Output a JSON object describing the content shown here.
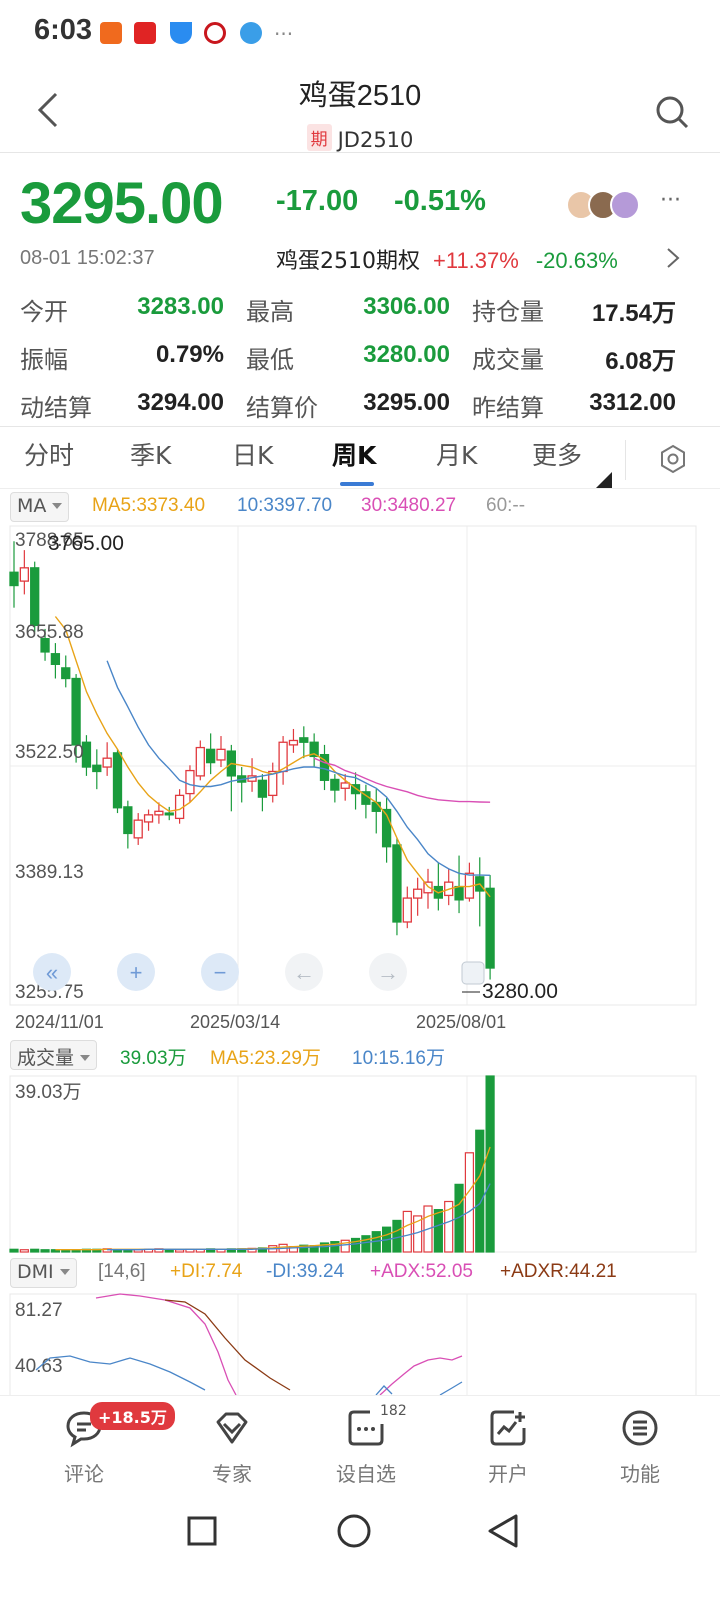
{
  "status_bar": {
    "time": "6:03",
    "more": "···"
  },
  "header": {
    "title": "鸡蛋2510",
    "tag": "期",
    "code": "JD2510"
  },
  "quote": {
    "last_price": "3295.00",
    "change": "-17.00",
    "change_pct": "-0.51%",
    "time": "08-01 15:02:37",
    "option_label": "鸡蛋2510期权",
    "option_up": "+11.37%",
    "option_down": "-20.63%",
    "more": "···"
  },
  "stats": [
    {
      "label": "今开",
      "value": "3283.00",
      "color": "green"
    },
    {
      "label": "最高",
      "value": "3306.00",
      "color": "green"
    },
    {
      "label": "持仓量",
      "value": "17.54万",
      "color": "black"
    },
    {
      "label": "振幅",
      "value": "0.79%",
      "color": "black"
    },
    {
      "label": "最低",
      "value": "3280.00",
      "color": "green"
    },
    {
      "label": "成交量",
      "value": "6.08万",
      "color": "black"
    },
    {
      "label": "动结算",
      "value": "3294.00",
      "color": "black"
    },
    {
      "label": "结算价",
      "value": "3295.00",
      "color": "black"
    },
    {
      "label": "昨结算",
      "value": "3312.00",
      "color": "black"
    }
  ],
  "tabs": [
    {
      "label": "分时",
      "active": false
    },
    {
      "label": "季K",
      "active": false
    },
    {
      "label": "日K",
      "active": false
    },
    {
      "label": "周K",
      "active": true
    },
    {
      "label": "月K",
      "active": false
    },
    {
      "label": "更多",
      "active": false
    }
  ],
  "ma_header": {
    "selector": "MA",
    "ma5": "MA5:3373.40",
    "ma10": "10:3397.70",
    "ma30": "30:3480.27",
    "ma60": "60:--"
  },
  "volume_header": {
    "selector": "成交量",
    "vol": "39.03万",
    "ma5": "MA5:23.29万",
    "ma10": "10:15.16万"
  },
  "dmi_header": {
    "selector": "DMI",
    "params": "[14,6]",
    "pdi": "+DI:7.74",
    "mdi": "-DI:39.24",
    "adx": "+ADX:52.05",
    "adxr": "+ADXR:44.21"
  },
  "colors": {
    "up": "#e0393e",
    "down": "#1a9b3c",
    "ma5": "#e8a317",
    "ma10": "#4a86c8",
    "ma30": "#d94fb5"
  },
  "chart_data": {
    "type": "candlestick",
    "y_ticks": [
      "3788.65",
      "3655.88",
      "3522.50",
      "3389.13",
      "3255.75"
    ],
    "ylim": [
      3255.75,
      3788.65
    ],
    "high_label": "3765.00",
    "low_label": "3280.00",
    "x_ticks": [
      "2024/11/01",
      "2025/03/14",
      "2025/08/01"
    ],
    "volume_max_label": "39.03万",
    "dmi_ticks": [
      "81.27",
      "40.63"
    ],
    "ohlc": [
      [
        3740,
        3775,
        3725,
        3700
      ],
      [
        3730,
        3765,
        3745,
        3715
      ],
      [
        3745,
        3752,
        3680,
        3672
      ],
      [
        3665,
        3676,
        3650,
        3640
      ],
      [
        3648,
        3660,
        3636,
        3620
      ],
      [
        3632,
        3646,
        3620,
        3610
      ],
      [
        3620,
        3625,
        3545,
        3525
      ],
      [
        3548,
        3556,
        3520,
        3510
      ],
      [
        3522,
        3540,
        3515,
        3495
      ],
      [
        3520,
        3548,
        3530,
        3510
      ],
      [
        3536,
        3540,
        3474,
        3468
      ],
      [
        3475,
        3482,
        3445,
        3428
      ],
      [
        3440,
        3468,
        3460,
        3432
      ],
      [
        3458,
        3472,
        3466,
        3448
      ],
      [
        3466,
        3480,
        3470,
        3456
      ],
      [
        3468,
        3475,
        3466,
        3460
      ],
      [
        3462,
        3495,
        3488,
        3456
      ],
      [
        3490,
        3522,
        3516,
        3480
      ],
      [
        3510,
        3550,
        3542,
        3505
      ],
      [
        3540,
        3558,
        3525,
        3512
      ],
      [
        3528,
        3555,
        3540,
        3520
      ],
      [
        3538,
        3545,
        3510,
        3470
      ],
      [
        3510,
        3520,
        3503,
        3480
      ],
      [
        3504,
        3530,
        3510,
        3492
      ],
      [
        3505,
        3512,
        3486,
        3470
      ],
      [
        3488,
        3525,
        3515,
        3480
      ],
      [
        3515,
        3555,
        3548,
        3500
      ],
      [
        3545,
        3563,
        3550,
        3536
      ],
      [
        3553,
        3566,
        3548,
        3530
      ],
      [
        3548,
        3558,
        3532,
        3520
      ],
      [
        3534,
        3545,
        3505,
        3494
      ],
      [
        3506,
        3512,
        3494,
        3480
      ],
      [
        3496,
        3512,
        3502,
        3482
      ],
      [
        3500,
        3514,
        3490,
        3472
      ],
      [
        3492,
        3500,
        3478,
        3462
      ],
      [
        3480,
        3495,
        3470,
        3445
      ],
      [
        3472,
        3485,
        3430,
        3412
      ],
      [
        3432,
        3440,
        3345,
        3330
      ],
      [
        3345,
        3385,
        3372,
        3338
      ],
      [
        3372,
        3395,
        3382,
        3352
      ],
      [
        3378,
        3405,
        3390,
        3360
      ],
      [
        3385,
        3412,
        3372,
        3358
      ],
      [
        3375,
        3405,
        3390,
        3364
      ],
      [
        3385,
        3420,
        3370,
        3355
      ],
      [
        3372,
        3412,
        3400,
        3368
      ],
      [
        3396,
        3418,
        3380,
        3340
      ],
      [
        3383,
        3398,
        3293,
        3280
      ]
    ],
    "volume": [
      0.6,
      0.5,
      0.6,
      0.5,
      0.5,
      0.4,
      0.5,
      0.6,
      0.6,
      0.7,
      0.5,
      0.5,
      0.5,
      0.6,
      0.7,
      0.5,
      0.5,
      0.6,
      0.6,
      0.7,
      0.6,
      0.7,
      0.7,
      0.8,
      0.9,
      1.4,
      1.7,
      1.2,
      1.5,
      1.4,
      2.0,
      2.3,
      2.6,
      3.0,
      3.6,
      4.5,
      5.5,
      7.0,
      9.0,
      8.0,
      10.2,
      9.4,
      11.2,
      15.0,
      22.0,
      27.0,
      39.03
    ],
    "ma5": [
      null,
      null,
      null,
      null,
      3690,
      3675,
      3640,
      3605,
      3580,
      3558,
      3540,
      3520,
      3502,
      3488,
      3478,
      3470,
      3472,
      3480,
      3492,
      3505,
      3515,
      3524,
      3522,
      3520,
      3515,
      3512,
      3518,
      3525,
      3532,
      3535,
      3528,
      3515,
      3505,
      3496,
      3488,
      3480,
      3466,
      3440,
      3415,
      3400,
      3385,
      3378,
      3382,
      3385,
      3385,
      3388,
      3373.4
    ],
    "ma10": [
      null,
      null,
      null,
      null,
      null,
      null,
      null,
      null,
      null,
      3640,
      3610,
      3588,
      3565,
      3545,
      3530,
      3518,
      3505,
      3500,
      3498,
      3498,
      3500,
      3504,
      3506,
      3508,
      3510,
      3512,
      3515,
      3518,
      3520,
      3520,
      3518,
      3514,
      3510,
      3508,
      3502,
      3496,
      3486,
      3470,
      3452,
      3438,
      3422,
      3412,
      3405,
      3400,
      3398,
      3398,
      3397.7
    ],
    "ma30": [
      null,
      null,
      null,
      null,
      null,
      null,
      null,
      null,
      null,
      null,
      null,
      null,
      null,
      null,
      null,
      null,
      null,
      null,
      null,
      null,
      null,
      null,
      null,
      null,
      null,
      null,
      null,
      null,
      null,
      3530,
      3525,
      3522,
      3516,
      3512,
      3507,
      3502,
      3498,
      3495,
      3492,
      3488,
      3485,
      3483,
      3482,
      3481,
      3481,
      3480.5,
      3480.27
    ],
    "vol_ma5": [
      null,
      null,
      null,
      null,
      0.5,
      0.5,
      0.5,
      0.5,
      0.5,
      0.6,
      0.6,
      0.6,
      0.6,
      0.6,
      0.6,
      0.6,
      0.6,
      0.6,
      0.6,
      0.6,
      0.6,
      0.6,
      0.7,
      0.7,
      0.8,
      0.9,
      1.1,
      1.2,
      1.3,
      1.4,
      1.6,
      1.7,
      2.0,
      2.3,
      2.7,
      3.2,
      3.8,
      4.7,
      5.9,
      6.8,
      7.9,
      8.7,
      9.4,
      10.6,
      13.6,
      16.9,
      23.29
    ],
    "vol_ma10": [
      null,
      null,
      null,
      null,
      null,
      null,
      null,
      null,
      null,
      0.5,
      0.5,
      0.5,
      0.5,
      0.6,
      0.6,
      0.6,
      0.6,
      0.6,
      0.6,
      0.6,
      0.6,
      0.6,
      0.6,
      0.6,
      0.7,
      0.7,
      0.8,
      0.9,
      1.0,
      1.1,
      1.2,
      1.4,
      1.6,
      1.8,
      2.1,
      2.4,
      2.7,
      3.2,
      3.7,
      4.3,
      5.1,
      5.9,
      6.7,
      7.7,
      9.0,
      10.7,
      15.16
    ],
    "dmi_pdi": [
      null,
      null,
      null,
      null,
      null,
      null,
      null,
      null,
      null,
      null,
      null,
      null,
      null,
      null,
      null,
      null,
      null,
      null,
      null,
      null,
      null,
      null,
      null,
      null,
      null,
      null,
      null,
      null,
      null,
      null,
      null,
      null,
      null,
      null,
      null,
      null,
      null,
      null,
      null,
      null,
      null,
      null,
      null,
      null,
      null,
      null,
      7.74
    ],
    "dmi_mdi": [
      null,
      null,
      null,
      null,
      null,
      null,
      null,
      null,
      null,
      null,
      null,
      null,
      null,
      null,
      null,
      null,
      null,
      null,
      null,
      null,
      null,
      null,
      null,
      null,
      null,
      null,
      null,
      null,
      null,
      null,
      null,
      null,
      null,
      null,
      null,
      null,
      null,
      null,
      null,
      null,
      null,
      null,
      null,
      null,
      null,
      null,
      39.24
    ],
    "dmi_adx": [
      null,
      null,
      null,
      null,
      null,
      null,
      null,
      null,
      null,
      null,
      null,
      null,
      null,
      null,
      null,
      null,
      null,
      null,
      null,
      null,
      null,
      null,
      null,
      null,
      null,
      null,
      null,
      null,
      null,
      null,
      null,
      null,
      null,
      null,
      null,
      null,
      null,
      null,
      null,
      null,
      null,
      null,
      null,
      null,
      null,
      null,
      52.05
    ],
    "dmi_adxr": [
      null,
      null,
      null,
      null,
      null,
      null,
      null,
      null,
      null,
      null,
      null,
      null,
      null,
      null,
      null,
      null,
      null,
      null,
      null,
      null,
      null,
      null,
      null,
      null,
      null,
      null,
      null,
      null,
      null,
      null,
      null,
      null,
      null,
      null,
      null,
      null,
      null,
      null,
      null,
      null,
      null,
      null,
      null,
      null,
      null,
      null,
      44.21
    ]
  },
  "bottom_nav": [
    {
      "label": "评论",
      "icon": "comment-icon"
    },
    {
      "label": "专家",
      "icon": "expert-icon"
    },
    {
      "label": "设自选",
      "icon": "watchlist-icon"
    },
    {
      "label": "开户",
      "icon": "open-account-icon"
    },
    {
      "label": "功能",
      "icon": "menu-icon"
    }
  ],
  "comment_badge": "+18.5万",
  "watchlist_count": "182"
}
